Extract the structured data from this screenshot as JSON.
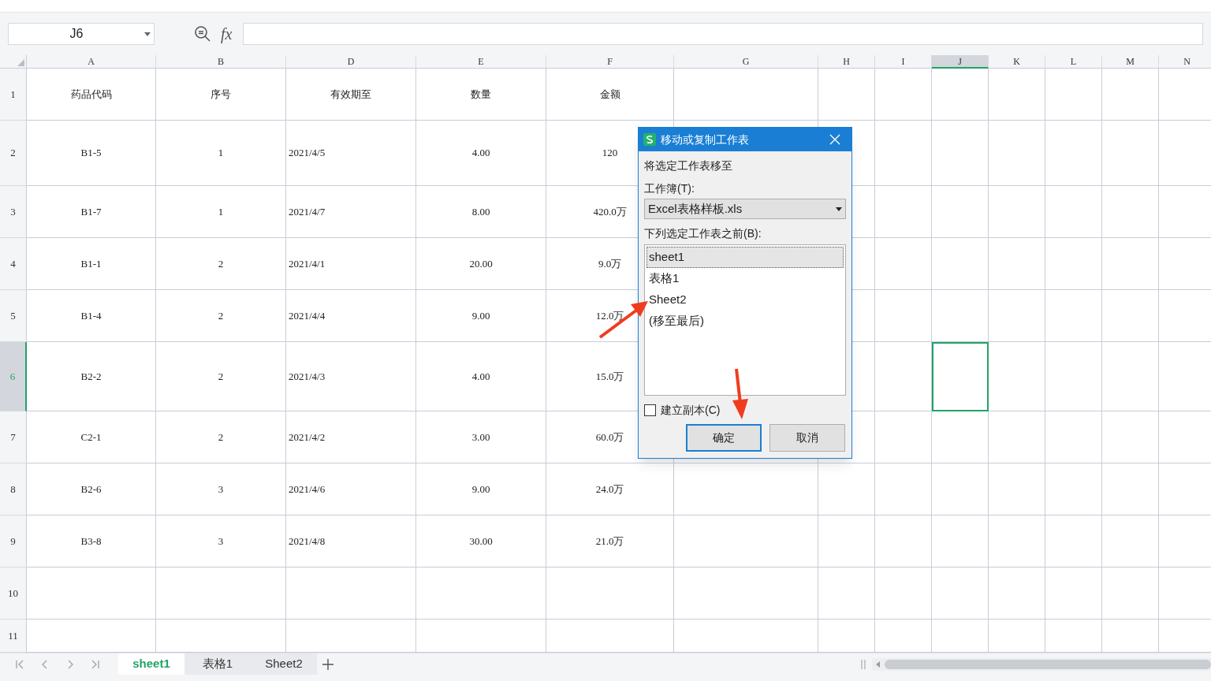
{
  "formula_bar": {
    "name_box": "J6",
    "function_label": "fx"
  },
  "columns": [
    {
      "label": "A",
      "selected": false
    },
    {
      "label": "B",
      "selected": false
    },
    {
      "label": "D",
      "selected": false
    },
    {
      "label": "E",
      "selected": false
    },
    {
      "label": "F",
      "selected": false
    },
    {
      "label": "G",
      "selected": false
    },
    {
      "label": "H",
      "selected": false
    },
    {
      "label": "I",
      "selected": false
    },
    {
      "label": "J",
      "selected": true
    },
    {
      "label": "K",
      "selected": false
    },
    {
      "label": "L",
      "selected": false
    },
    {
      "label": "M",
      "selected": false
    },
    {
      "label": "N",
      "selected": false
    }
  ],
  "rows": [
    {
      "label": "1",
      "selected": false,
      "cells": [
        "药品代码",
        "序号",
        "有效期至",
        "数量",
        "金额"
      ]
    },
    {
      "label": "2",
      "selected": false,
      "cells": [
        "B1-5",
        "1",
        "2021/4/5",
        "4.00",
        "120"
      ]
    },
    {
      "label": "3",
      "selected": false,
      "cells": [
        "B1-7",
        "1",
        "2021/4/7",
        "8.00",
        "420.0万"
      ]
    },
    {
      "label": "4",
      "selected": false,
      "cells": [
        "B1-1",
        "2",
        "2021/4/1",
        "20.00",
        "9.0万"
      ]
    },
    {
      "label": "5",
      "selected": false,
      "cells": [
        "B1-4",
        "2",
        "2021/4/4",
        "9.00",
        "12.0万"
      ]
    },
    {
      "label": "6",
      "selected": true,
      "cells": [
        "B2-2",
        "2",
        "2021/4/3",
        "4.00",
        "15.0万"
      ]
    },
    {
      "label": "7",
      "selected": false,
      "cells": [
        "C2-1",
        "2",
        "2021/4/2",
        "3.00",
        "60.0万"
      ]
    },
    {
      "label": "8",
      "selected": false,
      "cells": [
        "B2-6",
        "3",
        "2021/4/6",
        "9.00",
        "24.0万"
      ]
    },
    {
      "label": "9",
      "selected": false,
      "cells": [
        "B3-8",
        "3",
        "2021/4/8",
        "30.00",
        "21.0万"
      ]
    },
    {
      "label": "10",
      "selected": false,
      "cells": []
    },
    {
      "label": "11",
      "selected": false,
      "cells": []
    }
  ],
  "dialog": {
    "title": "移动或复制工作表",
    "instruction": "将选定工作表移至",
    "workbook_label": "工作簿(T):",
    "workbook_value": "Excel表格样板.xls",
    "list_label": "下列选定工作表之前(B):",
    "list_items": [
      {
        "label": "sheet1",
        "selected": true
      },
      {
        "label": "表格1",
        "selected": false
      },
      {
        "label": "Sheet2",
        "selected": false
      },
      {
        "label": "(移至最后)",
        "selected": false
      }
    ],
    "copy_checkbox": {
      "label": "建立副本(C)",
      "checked": false
    },
    "buttons": [
      {
        "label": "确定",
        "kind": "primary"
      },
      {
        "label": "取消",
        "kind": "secondary"
      }
    ]
  },
  "sheet_tabs": [
    {
      "label": "sheet1",
      "selected": true
    },
    {
      "label": "表格1",
      "selected": false
    },
    {
      "label": "Sheet2",
      "selected": false
    }
  ]
}
